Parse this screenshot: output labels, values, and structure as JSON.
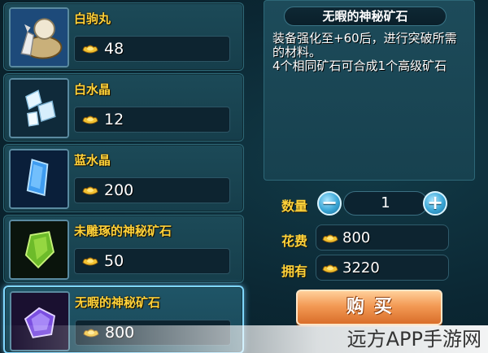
{
  "items": [
    {
      "name": "白驹丸",
      "price": "48",
      "icon": "horse-pill-icon"
    },
    {
      "name": "白水晶",
      "price": "12",
      "icon": "white-crystal-icon"
    },
    {
      "name": "蓝水晶",
      "price": "200",
      "icon": "blue-crystal-icon"
    },
    {
      "name": "未雕琢的神秘矿石",
      "price": "50",
      "icon": "green-ore-icon"
    },
    {
      "name": "无暇的神秘矿石",
      "price": "800",
      "icon": "purple-ore-icon",
      "selected": true
    }
  ],
  "detail": {
    "title": "无暇的神秘矿石",
    "description_line1": "装备强化至+60后，进行突破所需的材料。",
    "description_line2": "4个相同矿石可合成1个高级矿石"
  },
  "quantity": {
    "label": "数量",
    "value": "1",
    "minus": "−",
    "plus": "+"
  },
  "cost": {
    "label": "花费",
    "value": "800"
  },
  "owned": {
    "label": "拥有",
    "value": "3220"
  },
  "buy_label": "购买",
  "watermark": "远方APP手游网",
  "colors": {
    "item_name": "#ffd23a",
    "buy_button": "#f39a55",
    "selected_border": "#7fd7ff"
  }
}
